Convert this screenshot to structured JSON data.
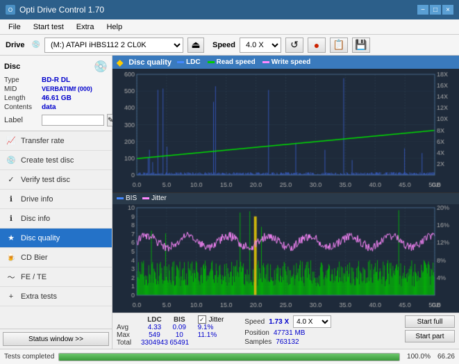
{
  "titleBar": {
    "title": "Opti Drive Control 1.70",
    "minimize": "−",
    "maximize": "□",
    "close": "×"
  },
  "menu": {
    "items": [
      "File",
      "Start test",
      "Extra",
      "Help"
    ]
  },
  "driveToolbar": {
    "driveLabel": "Drive",
    "driveValue": "(M:) ATAPI iHBS112  2 CL0K",
    "speedLabel": "Speed",
    "speedValue": "4.0 X"
  },
  "disc": {
    "title": "Disc",
    "type_label": "Type",
    "type_value": "BD-R DL",
    "mid_label": "MID",
    "mid_value": "VERBATIMf (000)",
    "length_label": "Length",
    "length_value": "46.61 GB",
    "contents_label": "Contents",
    "contents_value": "data",
    "label_label": "Label",
    "label_placeholder": ""
  },
  "navItems": [
    {
      "id": "transfer-rate",
      "label": "Transfer rate",
      "icon": "📈"
    },
    {
      "id": "create-test-disc",
      "label": "Create test disc",
      "icon": "💿"
    },
    {
      "id": "verify-test-disc",
      "label": "Verify test disc",
      "icon": "✓"
    },
    {
      "id": "drive-info",
      "label": "Drive info",
      "icon": "ℹ"
    },
    {
      "id": "disc-info",
      "label": "Disc info",
      "icon": "ℹ"
    },
    {
      "id": "disc-quality",
      "label": "Disc quality",
      "icon": "★",
      "active": true
    },
    {
      "id": "cd-bier",
      "label": "CD Bier",
      "icon": "🍺"
    },
    {
      "id": "fe-te",
      "label": "FE / TE",
      "icon": "~"
    },
    {
      "id": "extra-tests",
      "label": "Extra tests",
      "icon": "+"
    }
  ],
  "chartHeader": {
    "title": "Disc quality",
    "legend": [
      {
        "id": "ldc",
        "label": "LDC",
        "color": "#0000ff"
      },
      {
        "id": "read-speed",
        "label": "Read speed",
        "color": "#00cc00"
      },
      {
        "id": "write-speed",
        "label": "Write speed",
        "color": "#ff66ff"
      }
    ],
    "legend2": [
      {
        "id": "bis",
        "label": "BIS",
        "color": "#0000ff"
      },
      {
        "id": "jitter",
        "label": "Jitter",
        "color": "#ff66ff"
      }
    ]
  },
  "statsData": {
    "ldc_header": "LDC",
    "bis_header": "BIS",
    "jitter_header": "Jitter",
    "avg_label": "Avg",
    "max_label": "Max",
    "total_label": "Total",
    "avg_ldc": "4.33",
    "avg_bis": "0.09",
    "avg_jitter": "9.1%",
    "max_ldc": "549",
    "max_bis": "10",
    "max_jitter": "11.1%",
    "total_ldc": "3304943",
    "total_bis": "65491",
    "jitter_checked": "✓",
    "speed_label": "Speed",
    "position_label": "Position",
    "samples_label": "Samples",
    "speed_value": "1.73 X",
    "speed_select": "4.0 X",
    "position_value": "47731 MB",
    "samples_value": "763132",
    "start_full": "Start full",
    "start_part": "Start part"
  },
  "statusBar": {
    "text": "Tests completed",
    "progress": 100,
    "pct": "100.0%",
    "time": "66.26"
  }
}
